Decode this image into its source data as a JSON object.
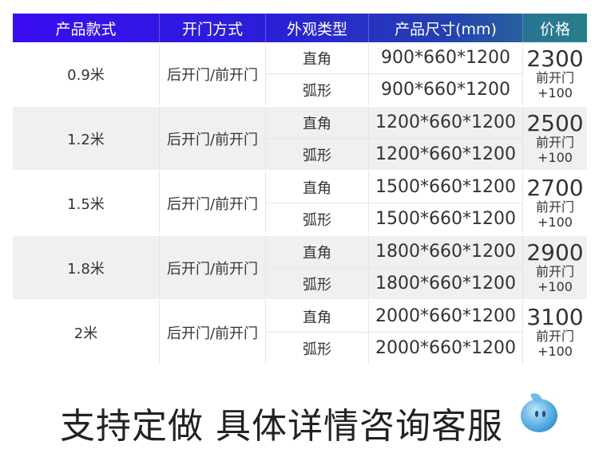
{
  "header": [
    "产品款式",
    "开门方式",
    "外观类型",
    "产品尺寸(mm)",
    "价格"
  ],
  "rows": [
    {
      "model": "0.9米",
      "door": "后开门/前开门",
      "types": [
        "直角",
        "弧形"
      ],
      "sizes": [
        "900*660*1200",
        "900*660*1200"
      ],
      "price": "2300",
      "extra": "前开门",
      "extra_price": "+100"
    },
    {
      "model": "1.2米",
      "door": "后开门/前开门",
      "types": [
        "直角",
        "弧形"
      ],
      "sizes": [
        "1200*660*1200",
        "1200*660*1200"
      ],
      "price": "2500",
      "extra": "前开门",
      "extra_price": "+100"
    },
    {
      "model": "1.5米",
      "door": "后开门/前开门",
      "types": [
        "直角",
        "弧形"
      ],
      "sizes": [
        "1500*660*1200",
        "1500*660*1200"
      ],
      "price": "2700",
      "extra": "前开门",
      "extra_price": "+100"
    },
    {
      "model": "1.8米",
      "door": "后开门/前开门",
      "types": [
        "直角",
        "弧形"
      ],
      "sizes": [
        "1800*660*1200",
        "1800*660*1200"
      ],
      "price": "2900",
      "extra": "前开门",
      "extra_price": "+100"
    },
    {
      "model": "2米",
      "door": "后开门/前开门",
      "types": [
        "直角",
        "弧形"
      ],
      "sizes": [
        "2000*660*1200",
        "2000*660*1200"
      ],
      "price": "3100",
      "extra": "前开门",
      "extra_price": "+100"
    }
  ],
  "footer": "支持定做 具体详情咨询客服",
  "colors": {
    "header_start": "#3a0cf0",
    "header_end": "#2c7a8e",
    "price": "#e8141c"
  },
  "icons": {
    "mascot": "water-drop-mascot-icon"
  }
}
